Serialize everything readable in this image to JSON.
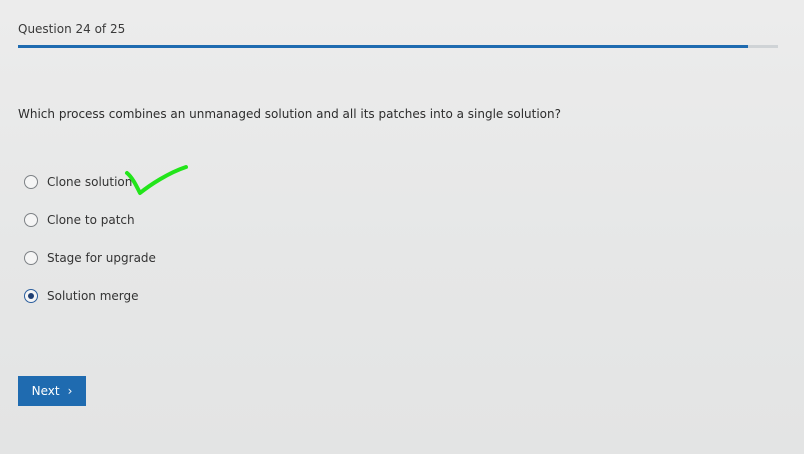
{
  "header": {
    "question_counter": "Question 24 of 25",
    "progress_fraction": 0.96
  },
  "question": {
    "text": "Which process combines an unmanaged solution and all its patches into a single solution?"
  },
  "options": [
    {
      "label": "Clone solution",
      "selected": false
    },
    {
      "label": "Clone to patch",
      "selected": false
    },
    {
      "label": "Stage for upgrade",
      "selected": false
    },
    {
      "label": "Solution merge",
      "selected": true
    }
  ],
  "annotation": {
    "icon": "handwritten-checkmark-icon",
    "color": "#22e51a"
  },
  "navigation": {
    "next_label": "Next",
    "next_icon": "chevron-right-icon"
  },
  "colors": {
    "accent": "#1f6bb0",
    "background": "#e9eaea"
  }
}
